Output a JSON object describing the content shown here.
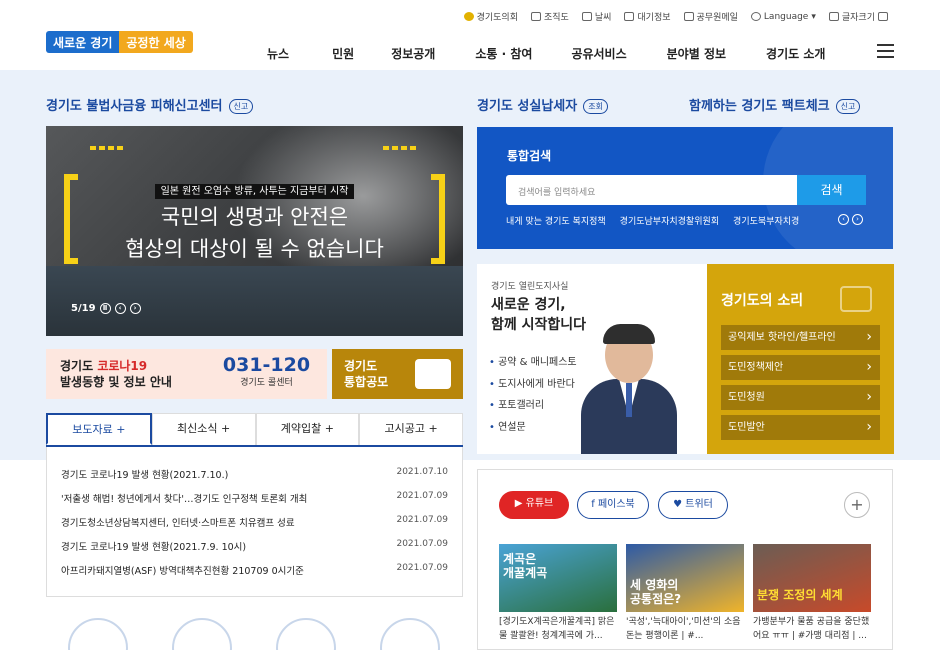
{
  "header": {
    "toplinks": [
      "경기도의회",
      "조직도",
      "날씨",
      "대기정보",
      "공무원메일",
      "Language",
      "글자크기"
    ],
    "logo_a": "새로운 경기",
    "logo_b": "공정한 세상",
    "gnb": [
      "뉴스",
      "민원",
      "정보공개",
      "소통 · 참여",
      "공유서비스",
      "분야별 정보",
      "경기도 소개"
    ]
  },
  "left": {
    "title": "경기도 불법사금융 피해신고센터",
    "title_pill": "신고",
    "banner": {
      "sub": "일본 원전 오염수 방류, 사투는 지금부터 시작",
      "line1": "국민의 생명과 안전은",
      "line2": "협상의 대상이 될 수 없습니다",
      "counter": "5/19"
    },
    "covid": {
      "line1_a": "경기도 ",
      "line1_b": "코로나19",
      "line2": "발생동향 및 정보 안내",
      "phone": "031-120",
      "phone_sub": "경기도 콜센터"
    },
    "gongmo": {
      "line1": "경기도",
      "line2": "통합공모"
    },
    "tabs": [
      "보도자료 +",
      "최신소식 +",
      "계약입찰 +",
      "고시공고 +"
    ],
    "news": [
      {
        "t": "경기도 코로나19 발생 현황(2021.7.10.)",
        "d": "2021.07.10"
      },
      {
        "t": "'저출생 해법! 청년에게서 찾다'…경기도 인구정책 토론회 개최",
        "d": "2021.07.09"
      },
      {
        "t": "경기도청소년상담복지센터, 인터넷·스마트폰 치유캠프 성료",
        "d": "2021.07.09"
      },
      {
        "t": "경기도 코로나19 발생 현황(2021.7.9. 10시)",
        "d": "2021.07.09"
      },
      {
        "t": "아프리카돼지열병(ASF) 방역대책추진현황 210709 0시기준",
        "d": "2021.07.09"
      }
    ]
  },
  "right": {
    "t1": "경기도 성실납세자",
    "t1_pill": "조회",
    "t2": "함께하는 경기도 팩트체크",
    "t2_pill": "신고",
    "search": {
      "title": "통합검색",
      "placeholder": "검색어를 입력하세요",
      "button": "검색",
      "keywords": [
        "내게 맞는 경기도 복지정책",
        "경기도남부자치경찰위원회",
        "경기도북부자치경"
      ]
    },
    "gov": {
      "kicker": "경기도 열린도지사실",
      "h1": "새로운 경기,",
      "h2": "함께 시작합니다",
      "items": [
        "공약 & 매니페스토",
        "도지사에게 바란다",
        "포토갤러리",
        "연설문"
      ]
    },
    "voice": {
      "title": "경기도의 소리",
      "items": [
        "공익제보 핫라인/헬프라인",
        "도민정책제안",
        "도민청원",
        "도민발안"
      ]
    },
    "sns": {
      "buttons": [
        "유튜브",
        "페이스북",
        "트위터"
      ],
      "plus": "+",
      "thumbs": [
        {
          "cap": "[경기도X계곡은개꿀계곡] 맑은물 콸콸완! 청계계곡에 가...",
          "tt": "계곡은\n개꿀계곡"
        },
        {
          "cap": "'곡성','늑대아이','미션'의 소음돈는 평행이론 | #...",
          "tt": "세 영화의\n공통점은?"
        },
        {
          "cap": "가뱅분부가 물품 공급을 중단했어요 ㅠㅠ | #가맹 대리점 | ...",
          "tt": "분쟁 조정의 세계"
        }
      ]
    }
  },
  "colors": {
    "brand": "#1b4aa0",
    "accent": "#1256c4",
    "gold": "#d4a50c",
    "red": "#d62a2a"
  }
}
